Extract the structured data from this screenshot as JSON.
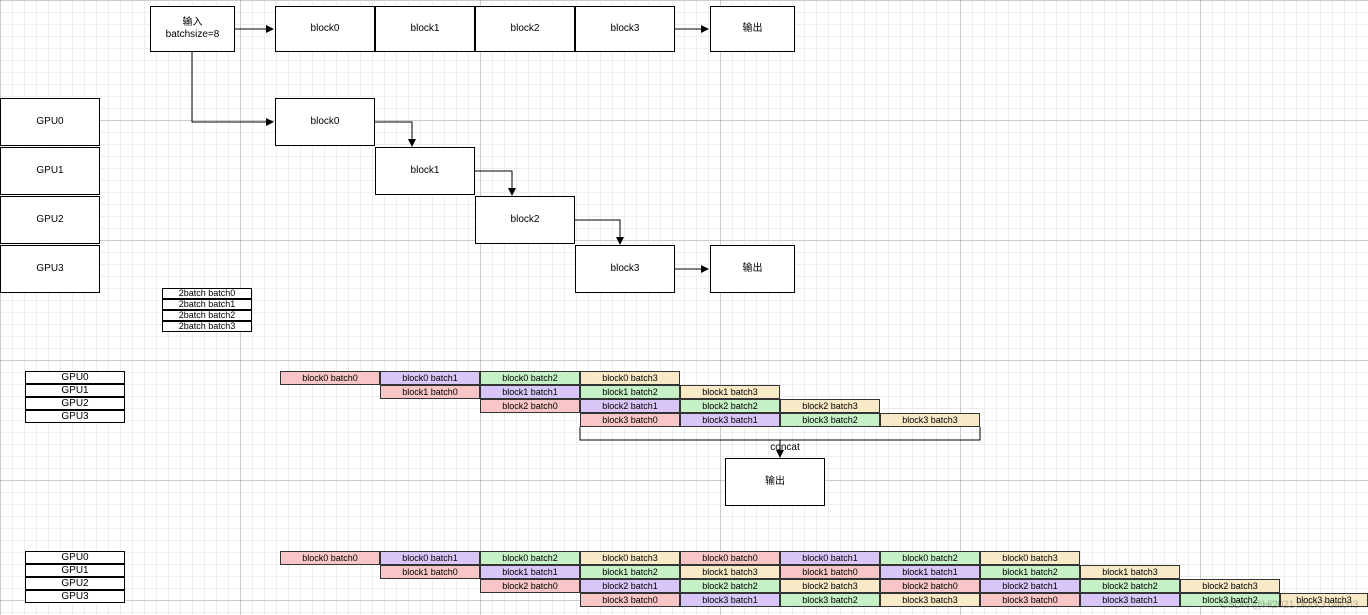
{
  "top": {
    "input_l1": "输入",
    "input_l2": "batchsize=8",
    "blocks": [
      "block0",
      "block1",
      "block2",
      "block3"
    ],
    "output": "输出"
  },
  "gpu_col": {
    "labels": [
      "GPU0",
      "GPU1",
      "GPU2",
      "GPU3"
    ]
  },
  "staircase": {
    "blocks": [
      "block0",
      "block1",
      "block2",
      "block3"
    ],
    "output": "输出"
  },
  "batch_split": {
    "rows": [
      "2batch batch0",
      "2batch batch1",
      "2batch batch2",
      "2batch batch3"
    ]
  },
  "pipeline_colors": {
    "batch0": "#f8c6c6",
    "batch1": "#d9c6f8",
    "batch2": "#c6f0c6",
    "batch3": "#f8eac6"
  },
  "pipeline1": {
    "gpu_labels": [
      "GPU0",
      "GPU1",
      "GPU2",
      "GPU3"
    ],
    "rows": [
      [
        "block0 batch0",
        "block0 batch1",
        "block0 batch2",
        "block0 batch3"
      ],
      [
        "block1 batch0",
        "block1 batch1",
        "block1 batch2",
        "block1 batch3"
      ],
      [
        "block2 batch0",
        "block2 batch1",
        "block2 batch2",
        "block2 batch3"
      ],
      [
        "block3 batch0",
        "block3 batch1",
        "block3 batch2",
        "block3 batch3"
      ]
    ],
    "concat_label": "concat",
    "output": "输出"
  },
  "pipeline2": {
    "gpu_labels": [
      "GPU0",
      "GPU1",
      "GPU2",
      "GPU3"
    ],
    "rows": [
      [
        "block0 batch0",
        "block0 batch1",
        "block0 batch2",
        "block0 batch3",
        "block0 batch0",
        "block0 batch1",
        "block0 batch2",
        "block0 batch3"
      ],
      [
        "block1 batch0",
        "block1 batch1",
        "block1 batch2",
        "block1 batch3",
        "block1 batch0",
        "block1 batch1",
        "block1 batch2",
        "block1 batch3"
      ],
      [
        "block2 batch0",
        "block2 batch1",
        "block2 batch2",
        "block2 batch3",
        "block2 batch0",
        "block2 batch1",
        "block2 batch2",
        "block2 batch3"
      ],
      [
        "block3 batch0",
        "block3 batch1",
        "block3 batch2",
        "block3 batch3",
        "block3 batch0",
        "block3 batch1",
        "block3 batch2",
        "block3 batch3"
      ]
    ]
  },
  "watermark": "CSDN @Hi2021 block3 batch3"
}
